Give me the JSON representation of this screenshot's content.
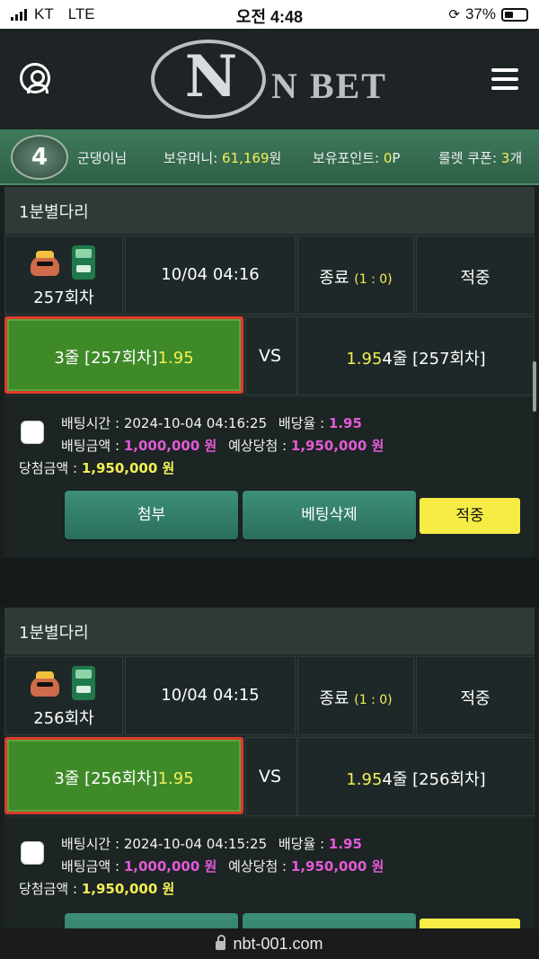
{
  "statusbar": {
    "carrier": "KT",
    "network": "LTE",
    "time": "오전 4:48",
    "battery": "37%"
  },
  "header": {
    "logo_letter": "N",
    "logo_text": "N BET"
  },
  "infobar": {
    "level": "4",
    "username": "군댕이님",
    "money_label": "보유머니:",
    "money_value": "61,169",
    "money_unit": "원",
    "point_label": "보유포인트:",
    "point_value": "0",
    "point_unit": "P",
    "coupon_label": "룰렛 쿠폰:",
    "coupon_value": "3",
    "coupon_unit": "개"
  },
  "bets": [
    {
      "section_title": "1분별다리",
      "round": "257회차",
      "datetime": "10/04 04:16",
      "status": "종료",
      "score": "(1 : 0)",
      "outcome": "적중",
      "pick": "3줄 [257회차]",
      "pick_odds": "1.95",
      "vs": "VS",
      "other_odds": "1.95",
      "other_pick": "4줄 [257회차]",
      "bet_time_label": "배팅시간 :",
      "bet_time": "2024-10-04 04:16:25",
      "odds_label": "배당율 :",
      "odds": "1.95",
      "amount_label": "배팅금액 :",
      "amount": "1,000,000 원",
      "expected_label": "예상당첨 :",
      "expected": "1,950,000 원",
      "win_label": "당첨금액 :",
      "win": "1,950,000 원",
      "attach_btn": "첨부",
      "delete_btn": "베팅삭제",
      "result_btn": "적중"
    },
    {
      "section_title": "1분별다리",
      "round": "256회차",
      "datetime": "10/04 04:15",
      "status": "종료",
      "score": "(1 : 0)",
      "outcome": "적중",
      "pick": "3줄 [256회차]",
      "pick_odds": "1.95",
      "vs": "VS",
      "other_odds": "1.95",
      "other_pick": "4줄 [256회차]",
      "bet_time_label": "배팅시간 :",
      "bet_time": "2024-10-04 04:15:25",
      "odds_label": "배당율 :",
      "odds": "1.95",
      "amount_label": "배팅금액 :",
      "amount": "1,000,000 원",
      "expected_label": "예상당첨 :",
      "expected": "1,950,000 원",
      "win_label": "당첨금액 :",
      "win": "1,950,000 원"
    }
  ],
  "urlbar": {
    "url": "nbt-001.com"
  }
}
